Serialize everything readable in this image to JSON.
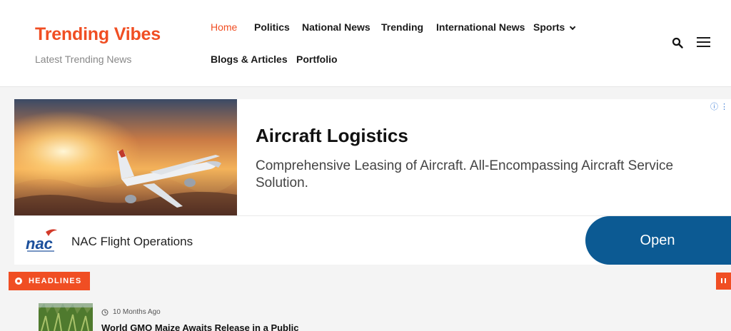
{
  "site": {
    "title": "Trending Vibes",
    "tagline": "Latest Trending News"
  },
  "nav": {
    "items": [
      {
        "label": "Home"
      },
      {
        "label": "Politics"
      },
      {
        "label": "National News"
      },
      {
        "label": "Trending"
      },
      {
        "label": "International News"
      },
      {
        "label": "Sports"
      },
      {
        "label": "Blogs & Articles"
      },
      {
        "label": "Portfolio"
      }
    ],
    "search_icon": "search-icon",
    "menu_icon": "hamburger-menu-icon"
  },
  "ad": {
    "title": "Aircraft Logistics",
    "description": "Comprehensive Leasing of Aircraft. All-Encompassing Aircraft Service Solution.",
    "advertiser": "NAC Flight Operations",
    "cta": "Open",
    "logo_text": "nac",
    "info_icon": "ad-info-icon"
  },
  "headlines": {
    "label": "HEADLINES",
    "item": {
      "time": "10 Months Ago",
      "title": "World GMO Maize Awaits Release in a Public"
    }
  },
  "colors": {
    "accent": "#f04e23",
    "cta": "#0c5a93"
  }
}
